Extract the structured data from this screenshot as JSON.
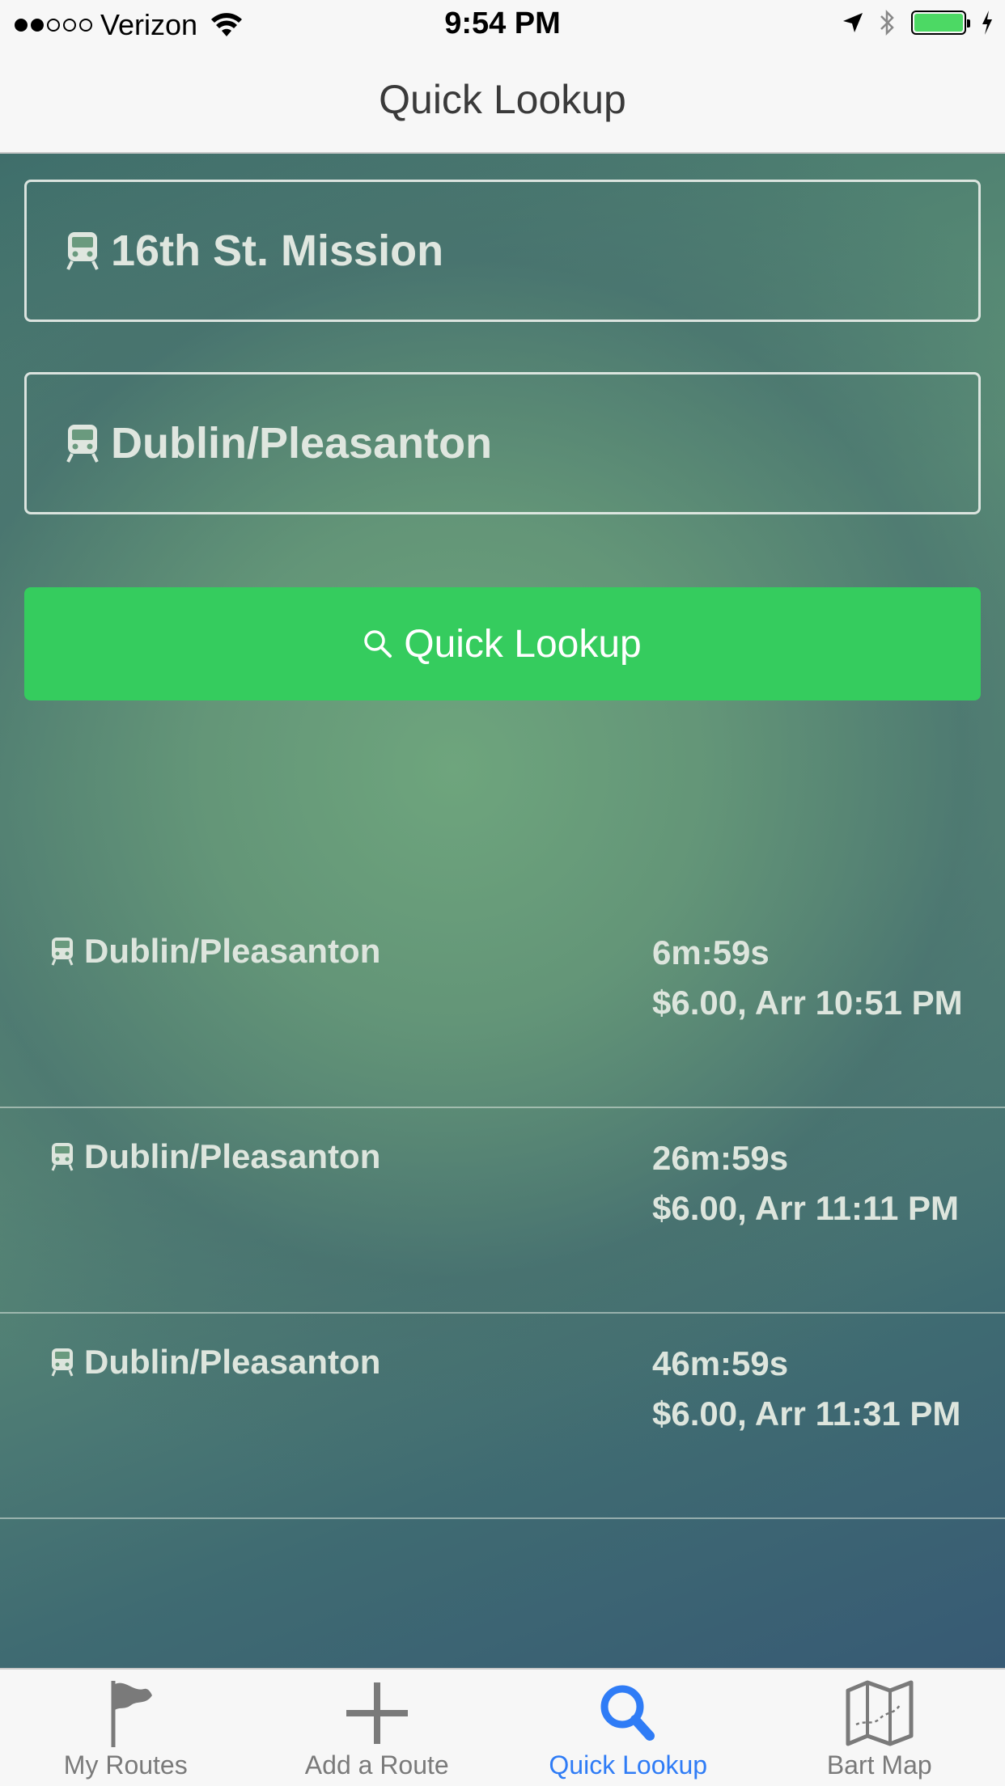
{
  "status_bar": {
    "carrier": "Verizon",
    "time": "9:54 PM",
    "battery_color": "#4cd964"
  },
  "nav": {
    "title": "Quick Lookup"
  },
  "origin": {
    "label": "16th St. Mission",
    "icon": "train-icon"
  },
  "destination": {
    "label": "Dublin/Pleasanton",
    "icon": "train-icon"
  },
  "lookup_button": {
    "label": "Quick Lookup",
    "icon": "search-icon",
    "color": "#35cc5e"
  },
  "results": [
    {
      "destination": "Dublin/Pleasanton",
      "eta": "6m:59s",
      "fare_arrival": "$6.00, Arr 10:51 PM"
    },
    {
      "destination": "Dublin/Pleasanton",
      "eta": "26m:59s",
      "fare_arrival": "$6.00, Arr 11:11 PM"
    },
    {
      "destination": "Dublin/Pleasanton",
      "eta": "46m:59s",
      "fare_arrival": "$6.00, Arr 11:31 PM"
    }
  ],
  "tabs": [
    {
      "label": "My Routes",
      "icon": "flag-icon"
    },
    {
      "label": "Add a Route",
      "icon": "plus-icon"
    },
    {
      "label": "Quick Lookup",
      "icon": "search-icon",
      "active": true
    },
    {
      "label": "Bart Map",
      "icon": "map-icon"
    }
  ],
  "colors": {
    "active_tab": "#2f7cf6",
    "inactive_tab": "#7a7a7a"
  }
}
